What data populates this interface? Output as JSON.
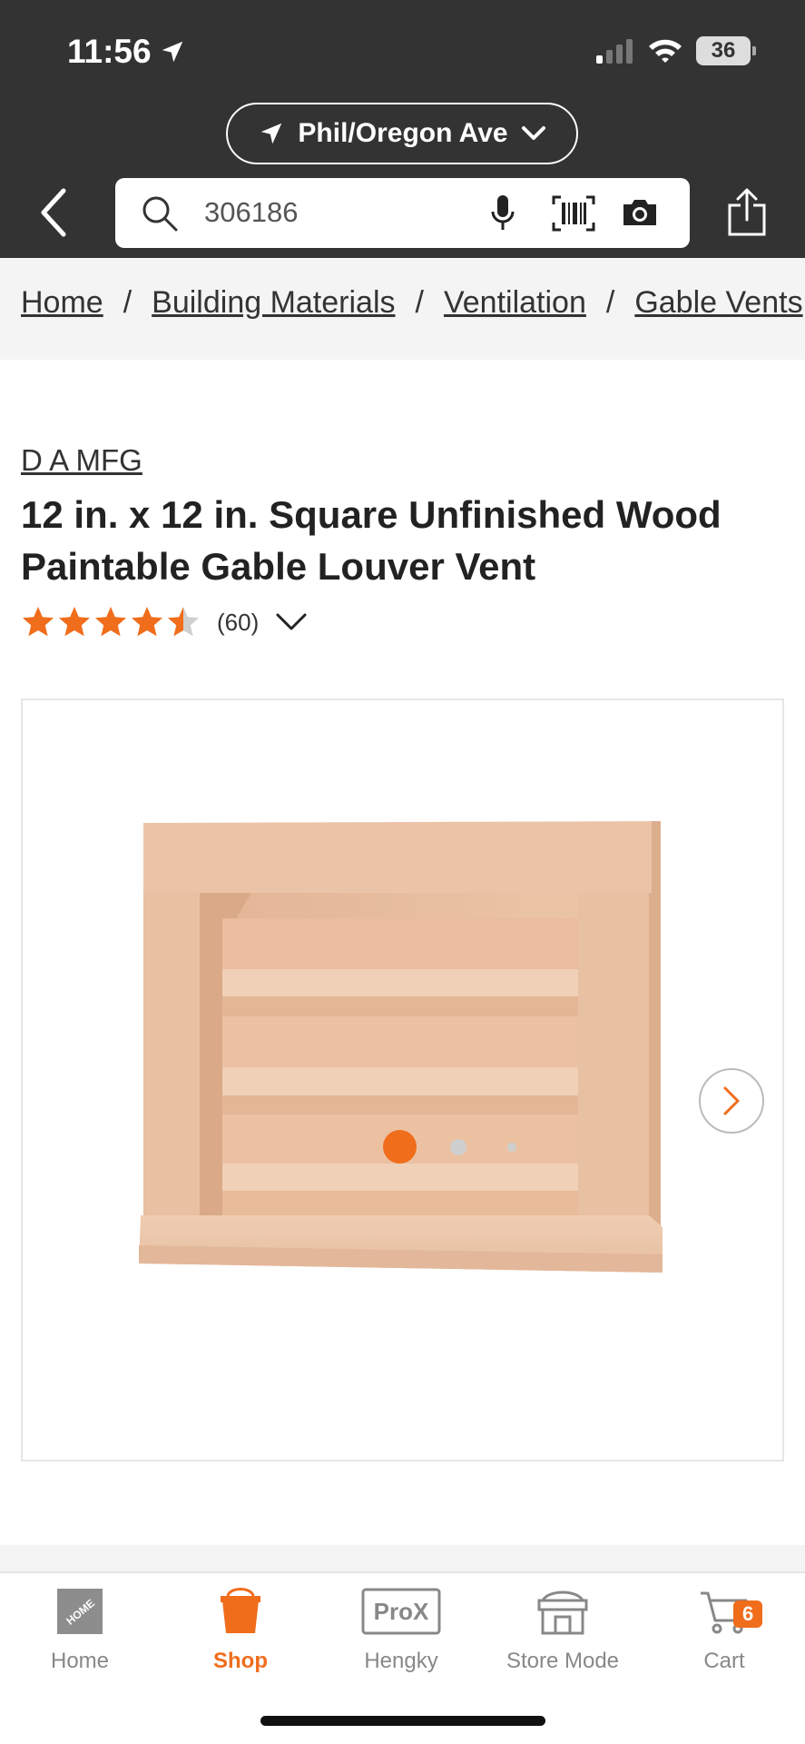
{
  "status_bar": {
    "time": "11:56",
    "battery": "36"
  },
  "location": {
    "label": "Phil/Oregon Ave"
  },
  "search": {
    "value": "306186"
  },
  "breadcrumb": {
    "items": [
      "Home",
      "Building Materials",
      "Ventilation",
      "Gable Vents"
    ],
    "separator": "/"
  },
  "product": {
    "brand": "D A MFG",
    "title": "12 in. x 12 in. Square Unfinished Wood Paintable Gable Louver Vent",
    "rating": 4.5,
    "rating_max": 5,
    "review_count": "(60)"
  },
  "gallery": {
    "image_count": 3,
    "active_index": 0
  },
  "bottom_nav": {
    "home": "Home",
    "shop": "Shop",
    "pro": "Hengky",
    "pro_logo": "ProX",
    "store_mode": "Store Mode",
    "cart": "Cart",
    "cart_count": "6"
  },
  "colors": {
    "accent": "#f06d1c",
    "header": "#333333",
    "wood": "#e8c2a4"
  }
}
